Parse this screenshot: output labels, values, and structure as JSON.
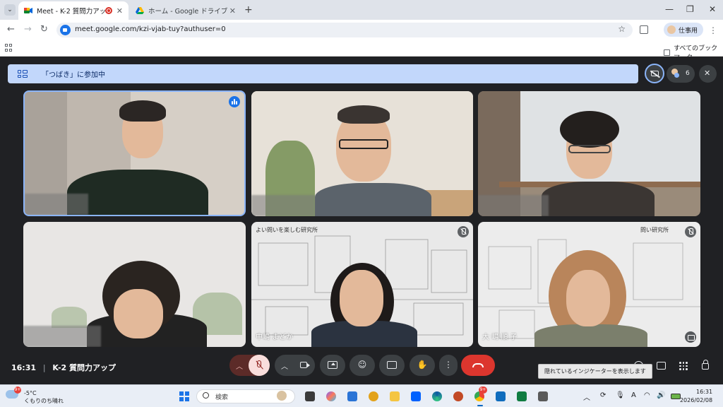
{
  "browser": {
    "tabs": [
      {
        "label": "Meet - K-2 質問力アップ",
        "active": true,
        "recording": true
      },
      {
        "label": "ホーム - Google ドライブ",
        "active": false
      }
    ],
    "url": "meet.google.com/kzi-vjab-tuy?authuser=0",
    "profile_label": "仕事用",
    "bookmarks_all": "すべてのブックマーク"
  },
  "meet": {
    "banner_text": "「つばき」に参加中",
    "participant_count": "6",
    "tiles": [
      {
        "name": "",
        "speaking": true,
        "muted": false
      },
      {
        "name": "",
        "speaking": false,
        "muted": false
      },
      {
        "name": "",
        "speaking": false,
        "muted": false
      },
      {
        "name": "",
        "speaking": false,
        "muted": false
      },
      {
        "name": "中嶋 まどか",
        "speaking": false,
        "muted": true,
        "caption": "よい問いを楽しむ研究所"
      },
      {
        "name": "大 嶋 順 子",
        "speaking": false,
        "muted": true,
        "caption": "問い研究所"
      }
    ],
    "time": "16:31",
    "meeting_title": "K-2 質問力アップ",
    "tooltip": "隠れているインジケーターを表示します"
  },
  "taskbar": {
    "temperature": "-5°C",
    "weather": "くもりのち晴れ",
    "weather_badge": "9+",
    "search_placeholder": "検索",
    "clock_time": "16:31",
    "clock_date": "2026/02/08",
    "chrome_badge": "9+"
  },
  "colors": {
    "accent": "#1a73e8",
    "hangup": "#dc362e",
    "mic_off_bg": "#f9dedc",
    "banner": "#c2d7fb",
    "meet_bg": "#202124"
  }
}
